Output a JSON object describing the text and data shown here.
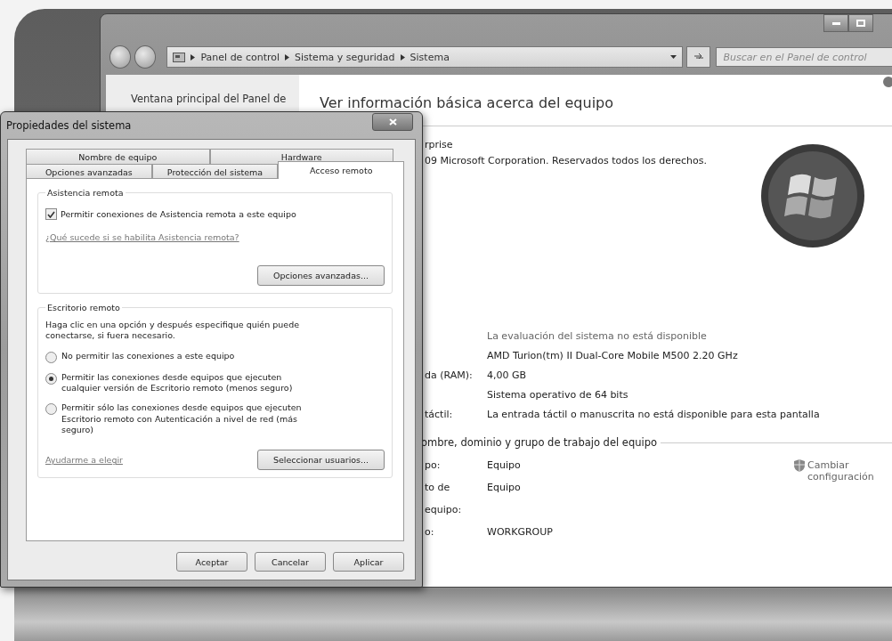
{
  "control_panel": {
    "breadcrumb": [
      "Panel de control",
      "Sistema y seguridad",
      "Sistema"
    ],
    "search": {
      "placeholder": "Buscar en el Panel de control"
    },
    "sidebar": {
      "link": "Ventana principal del Panel de"
    },
    "heading": "Ver información básica acerca del equipo",
    "edition_lines": [
      "rprise",
      "09 Microsoft Corporation. Reservados todos los derechos."
    ],
    "system_rows": [
      {
        "label": "",
        "value": "La evaluación del sistema no está disponible",
        "kind": "link"
      },
      {
        "label": "",
        "value": "AMD Turion(tm) II Dual-Core Mobile M500   2.20 GHz",
        "kind": "text"
      },
      {
        "label": "da (RAM):",
        "value": "4,00 GB",
        "kind": "text"
      },
      {
        "label": "",
        "value": "Sistema operativo de 64 bits",
        "kind": "text"
      },
      {
        "label": "táctil:",
        "value": "La entrada táctil o manuscrita no está disponible para esta pantalla",
        "kind": "text"
      }
    ],
    "network": {
      "heading": "ombre, dominio y grupo de trabajo del equipo",
      "change_link": "Cambiar configuración",
      "rows": [
        {
          "label": "po:",
          "value": "Equipo"
        },
        {
          "label": "to de",
          "value": "Equipo"
        },
        {
          "label": "equipo:",
          "value": ""
        },
        {
          "label": "o:",
          "value": "WORKGROUP"
        }
      ]
    }
  },
  "dialog": {
    "title": "Propiedades del sistema",
    "tab_rows": [
      {
        "tabs": [
          {
            "label": "Nombre de equipo",
            "selected": false
          },
          {
            "label": "Hardware",
            "selected": false
          }
        ]
      },
      {
        "tabs": [
          {
            "label": "Opciones avanzadas",
            "selected": false
          },
          {
            "label": "Protección del sistema",
            "selected": false
          },
          {
            "label": "Acceso remoto",
            "selected": true
          }
        ]
      }
    ],
    "remote_assistance": {
      "legend": "Asistencia remota",
      "checkbox": {
        "label": "Permitir conexiones de Asistencia remota a este equipo",
        "checked": true
      },
      "link": "¿Qué sucede si se habilita Asistencia remota?",
      "button": "Opciones avanzadas..."
    },
    "remote_desktop": {
      "legend": "Escritorio remoto",
      "description": "Haga clic en una opción y después especifique quién puede conectarse, si fuera necesario.",
      "options": [
        {
          "label": "No permitir las conexiones a este equipo",
          "selected": false
        },
        {
          "label": "Permitir las conexiones desde equipos que ejecuten cualquier versión de Escritorio remoto (menos seguro)",
          "selected": true
        },
        {
          "label": "Permitir sólo las conexiones desde equipos que ejecuten Escritorio remoto con Autenticación a nivel de red (más seguro)",
          "selected": false
        }
      ],
      "link": "Ayudarme a elegir",
      "button": "Seleccionar usuarios..."
    },
    "buttons": [
      "Aceptar",
      "Cancelar",
      "Aplicar"
    ]
  }
}
